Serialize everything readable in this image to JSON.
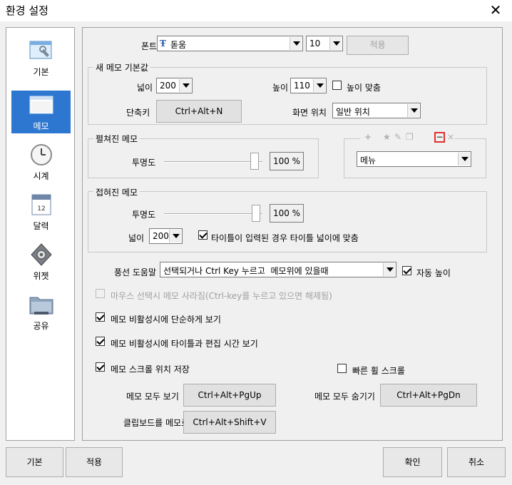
{
  "window": {
    "title": "환경 설정"
  },
  "sidebar": {
    "items": [
      {
        "label": "기본",
        "icon": "settings-window-icon"
      },
      {
        "label": "메모",
        "icon": "memo-window-icon",
        "selected": true
      },
      {
        "label": "시계",
        "icon": "clock-icon"
      },
      {
        "label": "달력",
        "icon": "calendar-icon",
        "calendar_day": "12"
      },
      {
        "label": "위젯",
        "icon": "widget-icon"
      },
      {
        "label": "공유",
        "icon": "folder-share-icon"
      }
    ]
  },
  "font_row": {
    "label": "폰트",
    "font_icon": "Ŧ",
    "font_value": "돋움",
    "size_value": "10",
    "apply_label": "적용"
  },
  "new_memo": {
    "title": "새 메모 기본값",
    "width_label": "넓이",
    "width_value": "200",
    "height_label": "높이",
    "height_value": "110",
    "fit_height_label": "높이 맞춤",
    "shortcut_label": "단축키",
    "shortcut_value": "Ctrl+Alt+N",
    "position_label": "화면 위치",
    "position_value": "일반 위치"
  },
  "expanded_memo": {
    "title": "펼쳐진 메모",
    "opacity_label": "투명도",
    "opacity_value": "100 %"
  },
  "menu_box": {
    "toolbar_glyphs": {
      "plus": "+",
      "star": "★",
      "pin": "✎",
      "copy": "❐",
      "minus": "−",
      "close": "×"
    },
    "menu_value": "메뉴"
  },
  "collapsed_memo": {
    "title": "접혀진 메모",
    "opacity_label": "투명도",
    "opacity_value": "100 %",
    "width_label": "넓이",
    "width_value": "200",
    "fit_title_label": "타이틀이 입력된 경우 타이틀 넓이에 맞춤"
  },
  "balloon": {
    "label": "풍선 도움말",
    "value": "선택되거나 Ctrl Key 누르고  메모위에 있을때",
    "auto_height_label": "자동 높이"
  },
  "options": {
    "mouse_hide": "마우스 선택시 메모 사라짐(Ctrl-key를 누르고 있으면 해제됨)",
    "simple_view": "메모 비활성시에 단순하게 보기",
    "title_time_view": "메모 비활성시에 타이틀과 편집 시간 보기",
    "save_scroll": "메모 스크롤 위치 저장",
    "fast_wheel": "빠른 휠 스크롤"
  },
  "hotkeys": {
    "show_all_label": "메모 모두 보기",
    "show_all_value": "Ctrl+Alt+PgUp",
    "hide_all_label": "메모 모두 숨기기",
    "hide_all_value": "Ctrl+Alt+PgDn",
    "clipboard_label": "클립보드를 메모로",
    "clipboard_value": "Ctrl+Alt+Shift+V"
  },
  "footer": {
    "default_label": "기본",
    "apply_label": "적용",
    "ok_label": "확인",
    "cancel_label": "취소"
  },
  "colors": {
    "accent": "#2e77d0",
    "minus_highlight": "#e03030"
  }
}
